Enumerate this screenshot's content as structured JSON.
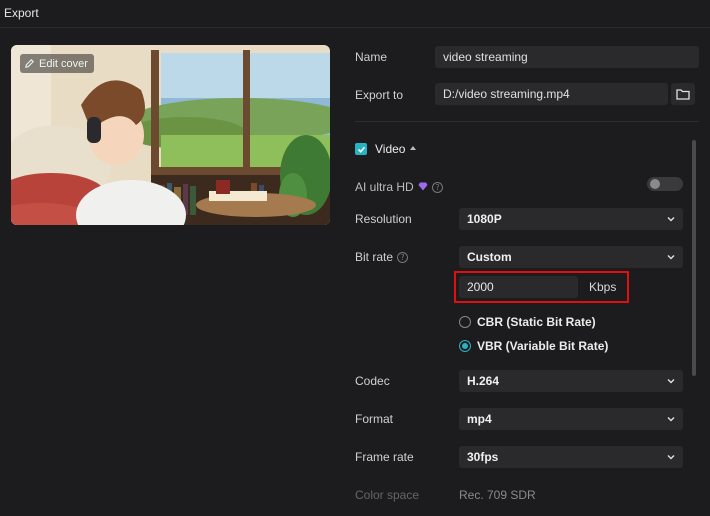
{
  "window": {
    "title": "Export"
  },
  "cover": {
    "edit_label": "Edit cover"
  },
  "fields": {
    "name": {
      "label": "Name",
      "value": "video streaming"
    },
    "export_to": {
      "label": "Export to",
      "value": "D:/video streaming.mp4"
    }
  },
  "video": {
    "section_label": "Video",
    "checked": true,
    "ai_ultra_hd": {
      "label": "AI ultra HD",
      "enabled": false
    },
    "resolution": {
      "label": "Resolution",
      "value": "1080P"
    },
    "bit_rate": {
      "label": "Bit rate",
      "mode": "Custom",
      "value": "2000",
      "unit": "Kbps"
    },
    "rate_modes": [
      {
        "label": "CBR (Static Bit Rate)",
        "selected": false
      },
      {
        "label": "VBR (Variable Bit Rate)",
        "selected": true
      }
    ],
    "codec": {
      "label": "Codec",
      "value": "H.264"
    },
    "format": {
      "label": "Format",
      "value": "mp4"
    },
    "frame_rate": {
      "label": "Frame rate",
      "value": "30fps"
    },
    "color_space": {
      "label": "Color space",
      "value": "Rec. 709 SDR"
    }
  },
  "colors": {
    "accent": "#26b3c4",
    "highlight": "#e01010",
    "background": "#1c1c1e",
    "field": "#2a2a2c"
  },
  "icons": [
    "edit-icon",
    "folder-icon",
    "check-icon",
    "caret-up-icon",
    "gem-icon",
    "help-icon",
    "chevron-down-icon"
  ]
}
